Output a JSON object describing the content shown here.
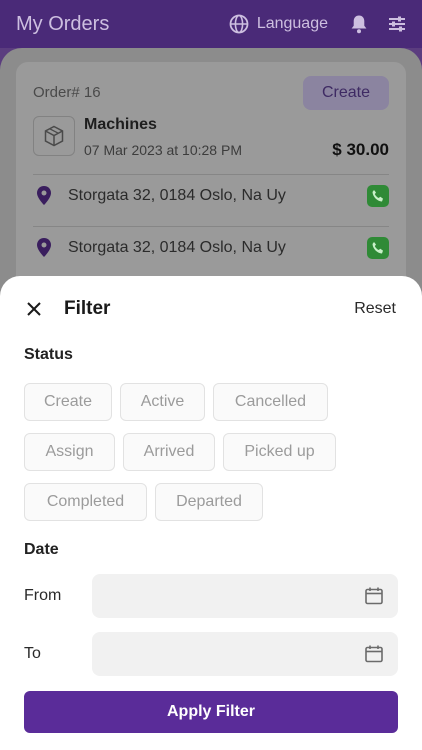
{
  "appbar": {
    "title": "My Orders",
    "language_label": "Language",
    "icons": [
      "globe-icon",
      "bell-icon",
      "tune-icon"
    ]
  },
  "order": {
    "id_label": "Order# 16",
    "status": "Create",
    "name": "Machines",
    "datetime": "07 Mar 2023 at 10:28 PM",
    "price": "$ 30.00",
    "pickup_address": "Storgata 32, 0184 Oslo, Na Uy",
    "dropoff_address": "Storgata 32, 0184 Oslo, Na Uy"
  },
  "filter": {
    "title": "Filter",
    "reset_label": "Reset",
    "status_label": "Status",
    "status_chips": [
      [
        "Create",
        "Active",
        "Cancelled"
      ],
      [
        "Assign",
        "Arrived",
        "Picked up"
      ],
      [
        "Completed",
        "Departed"
      ]
    ],
    "date_label": "Date",
    "from_label": "From",
    "to_label": "To",
    "apply_label": "Apply Filter"
  },
  "colors": {
    "primary": "#5a2c99",
    "appbar": "#4a2a78",
    "call_green": "#2f8a36"
  }
}
